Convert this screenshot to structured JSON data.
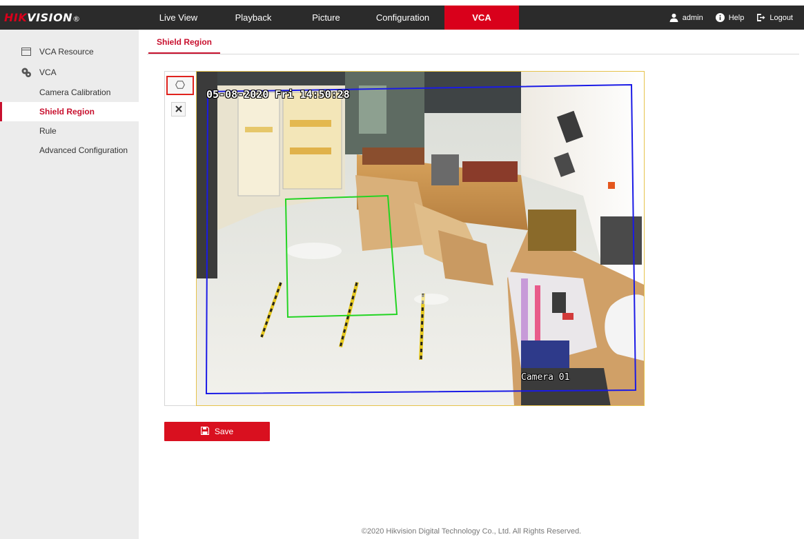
{
  "brand": {
    "logo_accent": "HIK",
    "logo_rest": "VISION",
    "logo_mark": "®",
    "accent_color": "#d9001b"
  },
  "nav": {
    "items": [
      {
        "label": "Live View"
      },
      {
        "label": "Playback"
      },
      {
        "label": "Picture"
      },
      {
        "label": "Configuration"
      },
      {
        "label": "VCA"
      }
    ],
    "active": "VCA",
    "user": "admin",
    "help": "Help",
    "logout": "Logout"
  },
  "sidebar": {
    "resource": {
      "label": "VCA Resource",
      "icon": "window-icon"
    },
    "vca": {
      "label": "VCA",
      "icon": "gears-icon"
    },
    "items": [
      {
        "label": "Camera Calibration"
      },
      {
        "label": "Shield Region",
        "active": true
      },
      {
        "label": "Rule"
      },
      {
        "label": "Advanced Configuration"
      }
    ]
  },
  "tab": {
    "label": "Shield Region"
  },
  "video": {
    "timestamp": "05-08-2020 Fri 14:50:28",
    "camera_name": "Camera 01",
    "full_region_color": "#1a1ae6",
    "shield_region_color": "#22d422"
  },
  "tools": {
    "draw": "hexagon-icon",
    "clear": "close-icon"
  },
  "save": {
    "label": "Save"
  },
  "footer": {
    "text": "©2020 Hikvision Digital Technology Co., Ltd. All Rights Reserved."
  }
}
